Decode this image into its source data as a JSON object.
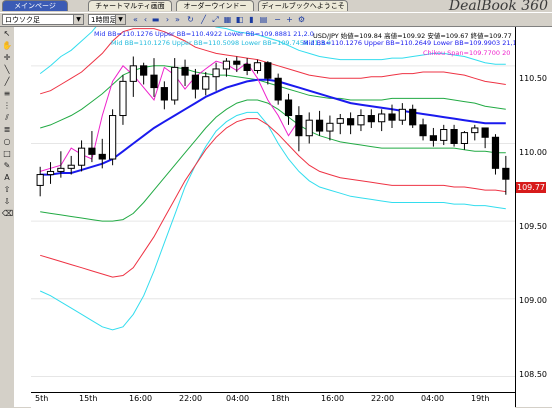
{
  "tabs": [
    {
      "label": "メインページ",
      "active": true
    },
    {
      "label": "チャートマルティ画面",
      "active": false
    },
    {
      "label": "オーダーウインドー",
      "active": false
    },
    {
      "label": "ディールブックへようこそ",
      "active": false
    }
  ],
  "brand": "DealBook 360",
  "toolbar": {
    "symbol": "ロウソク足",
    "timeframe": "1時間足"
  },
  "legend": {
    "bb_blue": "Mid BB=110.1276 Upper BB=110.4922 Lower BB=109.8881",
    "bb_blue_period": "21,2.0",
    "quote": "USD/JPY 始値=109.84 高値=109.92 安値=109.67 終値=109.77",
    "bb_cyan": "Mid BB=110.1276 Upper BB=110.5098 Lower BB=109.7458",
    "bb_cyan_period": "21,3.0",
    "bb_darkblue": "Mid BB=110.1276 Upper BB=110.2649 Lower BB=109.9903",
    "bb_darkblue_period": "21,1.0",
    "chikou": "Chikou Span=109.7700",
    "chikou_period": "20"
  },
  "price_axis": {
    "labels": [
      "110.50",
      "110.00",
      "109.50",
      "109.00",
      "108.50"
    ],
    "current": "109.77"
  },
  "time_axis": {
    "labels": [
      "5th",
      "15th",
      "16:00",
      "22:00",
      "04:00",
      "18th",
      "16:00",
      "22:00",
      "04:00",
      "19th"
    ]
  },
  "colors": {
    "bollinger_3sigma": "#33ddee",
    "bollinger_2sigma": "#ee3344",
    "bollinger_1sigma": "#22aa44",
    "mid_line": "#1a1aee",
    "chikou": "#ee22cc",
    "current_price_tag": "#d71b1b"
  },
  "chart_data": {
    "type": "line",
    "title": "USD/JPY",
    "ylim": [
      108.4,
      110.75
    ],
    "candles": [
      {
        "o": 109.73,
        "h": 109.85,
        "l": 109.66,
        "c": 109.8
      },
      {
        "o": 109.8,
        "h": 109.88,
        "l": 109.74,
        "c": 109.82
      },
      {
        "o": 109.82,
        "h": 109.95,
        "l": 109.78,
        "c": 109.84
      },
      {
        "o": 109.84,
        "h": 109.92,
        "l": 109.8,
        "c": 109.86
      },
      {
        "o": 109.86,
        "h": 110.02,
        "l": 109.82,
        "c": 109.97
      },
      {
        "o": 109.97,
        "h": 110.08,
        "l": 109.88,
        "c": 109.93
      },
      {
        "o": 109.93,
        "h": 110.03,
        "l": 109.84,
        "c": 109.9
      },
      {
        "o": 109.9,
        "h": 110.22,
        "l": 109.86,
        "c": 110.18
      },
      {
        "o": 110.18,
        "h": 110.44,
        "l": 110.12,
        "c": 110.4
      },
      {
        "o": 110.4,
        "h": 110.56,
        "l": 110.3,
        "c": 110.5
      },
      {
        "o": 110.5,
        "h": 110.52,
        "l": 110.38,
        "c": 110.44
      },
      {
        "o": 110.44,
        "h": 110.55,
        "l": 110.3,
        "c": 110.36
      },
      {
        "o": 110.36,
        "h": 110.4,
        "l": 110.22,
        "c": 110.28
      },
      {
        "o": 110.28,
        "h": 110.55,
        "l": 110.25,
        "c": 110.49
      },
      {
        "o": 110.49,
        "h": 110.54,
        "l": 110.37,
        "c": 110.44
      },
      {
        "o": 110.44,
        "h": 110.48,
        "l": 110.29,
        "c": 110.35
      },
      {
        "o": 110.35,
        "h": 110.46,
        "l": 110.31,
        "c": 110.43
      },
      {
        "o": 110.43,
        "h": 110.52,
        "l": 110.34,
        "c": 110.48
      },
      {
        "o": 110.48,
        "h": 110.55,
        "l": 110.43,
        "c": 110.53
      },
      {
        "o": 110.53,
        "h": 110.56,
        "l": 110.46,
        "c": 110.51
      },
      {
        "o": 110.51,
        "h": 110.55,
        "l": 110.44,
        "c": 110.47
      },
      {
        "o": 110.47,
        "h": 110.54,
        "l": 110.45,
        "c": 110.52
      },
      {
        "o": 110.52,
        "h": 110.53,
        "l": 110.38,
        "c": 110.42
      },
      {
        "o": 110.42,
        "h": 110.45,
        "l": 110.25,
        "c": 110.28
      },
      {
        "o": 110.28,
        "h": 110.32,
        "l": 110.12,
        "c": 110.18
      },
      {
        "o": 110.18,
        "h": 110.24,
        "l": 109.95,
        "c": 110.05
      },
      {
        "o": 110.05,
        "h": 110.2,
        "l": 110.0,
        "c": 110.15
      },
      {
        "o": 110.15,
        "h": 110.21,
        "l": 110.05,
        "c": 110.08
      },
      {
        "o": 110.08,
        "h": 110.18,
        "l": 110.02,
        "c": 110.13
      },
      {
        "o": 110.13,
        "h": 110.19,
        "l": 110.06,
        "c": 110.16
      },
      {
        "o": 110.16,
        "h": 110.2,
        "l": 110.06,
        "c": 110.12
      },
      {
        "o": 110.12,
        "h": 110.22,
        "l": 110.08,
        "c": 110.18
      },
      {
        "o": 110.18,
        "h": 110.22,
        "l": 110.1,
        "c": 110.14
      },
      {
        "o": 110.14,
        "h": 110.22,
        "l": 110.08,
        "c": 110.19
      },
      {
        "o": 110.19,
        "h": 110.25,
        "l": 110.1,
        "c": 110.15
      },
      {
        "o": 110.15,
        "h": 110.26,
        "l": 110.12,
        "c": 110.22
      },
      {
        "o": 110.22,
        "h": 110.25,
        "l": 110.1,
        "c": 110.12
      },
      {
        "o": 110.12,
        "h": 110.16,
        "l": 110.02,
        "c": 110.05
      },
      {
        "o": 110.05,
        "h": 110.1,
        "l": 109.98,
        "c": 110.02
      },
      {
        "o": 110.02,
        "h": 110.12,
        "l": 109.99,
        "c": 110.09
      },
      {
        "o": 110.09,
        "h": 110.12,
        "l": 109.98,
        "c": 110.0
      },
      {
        "o": 110.0,
        "h": 110.08,
        "l": 109.96,
        "c": 110.07
      },
      {
        "o": 110.07,
        "h": 110.12,
        "l": 110.02,
        "c": 110.1
      },
      {
        "o": 110.1,
        "h": 110.1,
        "l": 109.97,
        "c": 110.04
      },
      {
        "o": 110.04,
        "h": 110.06,
        "l": 109.8,
        "c": 109.84
      },
      {
        "o": 109.84,
        "h": 109.92,
        "l": 109.67,
        "c": 109.77
      }
    ],
    "bb_upper3": [
      110.45,
      110.5,
      110.56,
      110.6,
      110.66,
      110.72,
      110.8,
      110.88,
      110.92,
      110.94,
      110.96,
      110.96,
      110.93,
      110.9,
      110.86,
      110.81,
      110.78,
      110.75,
      110.74,
      110.72,
      110.71,
      110.7,
      110.68,
      110.66,
      110.63,
      110.6,
      110.58,
      110.56,
      110.55,
      110.54,
      110.54,
      110.54,
      110.54,
      110.54,
      110.55,
      110.55,
      110.56,
      110.57,
      110.58,
      110.58,
      110.57,
      110.56,
      110.54,
      110.52,
      110.51,
      110.51
    ],
    "bb_upper2": [
      110.32,
      110.34,
      110.38,
      110.42,
      110.46,
      110.52,
      110.58,
      110.66,
      110.72,
      110.74,
      110.74,
      110.74,
      110.72,
      110.69,
      110.66,
      110.62,
      110.6,
      110.58,
      110.57,
      110.56,
      110.55,
      110.54,
      110.52,
      110.5,
      110.48,
      110.46,
      110.44,
      110.43,
      110.42,
      110.42,
      110.42,
      110.42,
      110.43,
      110.43,
      110.44,
      110.45,
      110.45,
      110.46,
      110.46,
      110.46,
      110.45,
      110.44,
      110.42,
      110.4,
      110.39,
      110.38
    ],
    "bb_upper1": [
      110.1,
      110.12,
      110.15,
      110.18,
      110.22,
      110.27,
      110.32,
      110.38,
      110.44,
      110.47,
      110.49,
      110.5,
      110.5,
      110.49,
      110.48,
      110.46,
      110.45,
      110.44,
      110.44,
      110.43,
      110.42,
      110.41,
      110.39,
      110.37,
      110.35,
      110.33,
      110.31,
      110.3,
      110.29,
      110.29,
      110.28,
      110.28,
      110.28,
      110.28,
      110.29,
      110.29,
      110.29,
      110.29,
      110.29,
      110.29,
      110.28,
      110.27,
      110.26,
      110.24,
      110.23,
      110.22
    ],
    "bb_mid": [
      109.8,
      109.8,
      109.81,
      109.81,
      109.83,
      109.85,
      109.87,
      109.9,
      109.95,
      110.0,
      110.05,
      110.1,
      110.14,
      110.18,
      110.22,
      110.26,
      110.3,
      110.33,
      110.36,
      110.38,
      110.4,
      110.41,
      110.41,
      110.4,
      110.38,
      110.36,
      110.34,
      110.32,
      110.3,
      110.28,
      110.26,
      110.25,
      110.24,
      110.23,
      110.22,
      110.21,
      110.2,
      110.19,
      110.18,
      110.17,
      110.16,
      110.15,
      110.14,
      110.13,
      110.13,
      110.13
    ],
    "bb_lower1": [
      109.56,
      109.55,
      109.54,
      109.53,
      109.52,
      109.51,
      109.5,
      109.5,
      109.51,
      109.55,
      109.62,
      109.7,
      109.78,
      109.86,
      109.94,
      110.02,
      110.1,
      110.17,
      110.22,
      110.26,
      110.28,
      110.28,
      110.26,
      110.22,
      110.17,
      110.12,
      110.08,
      110.05,
      110.03,
      110.01,
      110.0,
      109.99,
      109.98,
      109.97,
      109.97,
      109.97,
      109.97,
      109.97,
      109.97,
      109.97,
      109.97,
      109.96,
      109.95,
      109.95,
      109.94,
      109.94
    ],
    "bb_lower2": [
      109.28,
      109.26,
      109.24,
      109.22,
      109.2,
      109.18,
      109.16,
      109.14,
      109.15,
      109.2,
      109.3,
      109.4,
      109.52,
      109.64,
      109.76,
      109.86,
      109.96,
      110.04,
      110.1,
      110.14,
      110.16,
      110.16,
      110.12,
      110.06,
      109.99,
      109.92,
      109.86,
      109.82,
      109.8,
      109.78,
      109.77,
      109.76,
      109.75,
      109.74,
      109.73,
      109.73,
      109.73,
      109.73,
      109.73,
      109.73,
      109.72,
      109.72,
      109.71,
      109.7,
      109.7,
      109.69
    ],
    "bb_lower3": [
      109.05,
      109.02,
      108.98,
      108.94,
      108.9,
      108.86,
      108.82,
      108.8,
      108.82,
      108.9,
      109.02,
      109.18,
      109.36,
      109.54,
      109.72,
      109.86,
      109.98,
      110.08,
      110.14,
      110.18,
      110.2,
      110.2,
      110.12,
      110.0,
      109.9,
      109.82,
      109.76,
      109.72,
      109.7,
      109.68,
      109.66,
      109.65,
      109.64,
      109.63,
      109.62,
      109.62,
      109.62,
      109.62,
      109.62,
      109.62,
      109.61,
      109.61,
      109.6,
      109.6,
      109.59,
      109.58
    ],
    "chikou": [
      109.82,
      109.84,
      109.86,
      109.97,
      109.93,
      109.9,
      110.18,
      110.4,
      110.5,
      110.44,
      110.36,
      110.28,
      110.49,
      110.44,
      110.35,
      110.43,
      110.48,
      110.53,
      110.51,
      110.47,
      110.52,
      110.42,
      110.28,
      110.18,
      110.05,
      110.15
    ]
  }
}
